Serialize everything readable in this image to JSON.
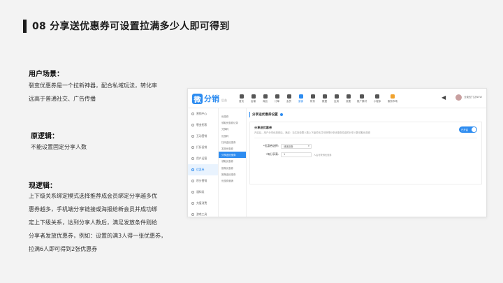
{
  "slide": {
    "title": "08 分享送优惠券可设置拉满多少人即可得到",
    "scene_heading": "用户场景：",
    "scene_lines": [
      "裂变优惠券是一个拉新神器，配合私域玩法，转化率",
      "远高于普通社交、广告传播"
    ],
    "old_heading": "原逻辑：",
    "old_lines": [
      "不能设置固定分享人数"
    ],
    "new_heading": "现逻辑：",
    "new_lines": [
      "上下级关系绑定模式选择推荐成会员绑定分享越多优",
      "惠券越多，手机端分享链接或海报给新会员并成功绑",
      "定上下级关系，达到分享人数后，满足发放条件则给",
      "分享者发放优惠券，例如：设置的满3人得一张优惠券，",
      "拉满6人即可得到2张优惠券"
    ]
  },
  "app": {
    "logo_glyph": "微",
    "logo_text": "分销",
    "logo_sub": "后台",
    "nav": [
      {
        "label": "首页",
        "icon": "home-icon"
      },
      {
        "label": "店铺",
        "icon": "store-icon"
      },
      {
        "label": "商品",
        "icon": "goods-icon"
      },
      {
        "label": "订单",
        "icon": "order-icon"
      },
      {
        "label": "会员",
        "icon": "member-icon"
      },
      {
        "label": "营销",
        "icon": "marketing-icon",
        "active": true
      },
      {
        "label": "财务",
        "icon": "finance-icon"
      },
      {
        "label": "数据",
        "icon": "data-icon"
      },
      {
        "label": "应用",
        "icon": "apps-icon"
      },
      {
        "label": "设置",
        "icon": "settings-icon"
      },
      {
        "label": "推广素材",
        "icon": "promo-icon"
      },
      {
        "label": "小程序",
        "icon": "miniapp-icon"
      },
      {
        "label": "服务市场",
        "icon": "market-icon"
      }
    ],
    "shop_name": "全能型门店NEW",
    "sidebar": [
      {
        "label": "营销中心"
      },
      {
        "label": "裂变拓客"
      },
      {
        "label": "互动营销"
      },
      {
        "label": "打折促销"
      },
      {
        "label": "用户运营"
      },
      {
        "label": "优惠券",
        "active": true
      },
      {
        "label": "积分营销"
      },
      {
        "label": "通知类"
      },
      {
        "label": "充值消费"
      },
      {
        "label": "游戏工具"
      }
    ],
    "subnav": [
      {
        "label": "优惠券"
      },
      {
        "label": "领取优惠券记录"
      },
      {
        "label": "兑换码"
      },
      {
        "label": "优惠码"
      },
      {
        "label": "扫码送优惠券"
      },
      {
        "label": "发放优惠券"
      },
      {
        "label": "分享送优惠券",
        "active": true
      },
      {
        "label": "领取优惠券"
      },
      {
        "label": "推荐优惠券"
      },
      {
        "label": "推荐送优惠券"
      },
      {
        "label": "优惠券营销"
      }
    ],
    "page_title": "分享送优惠券设置",
    "panel_title": "分享送优惠券",
    "panel_desc": "开启后，用户分享优惠券后，满足：当达到设置人数上下级关系并可获得分享优惠券总送的分享人数领取优惠券",
    "toggle_label": "已开启",
    "field1_label": "*优惠券选择:",
    "field1_value": "请选择券",
    "field2_label": "*每分享满:",
    "field2_value": "1",
    "field2_hint": "人后可获得优惠券"
  }
}
